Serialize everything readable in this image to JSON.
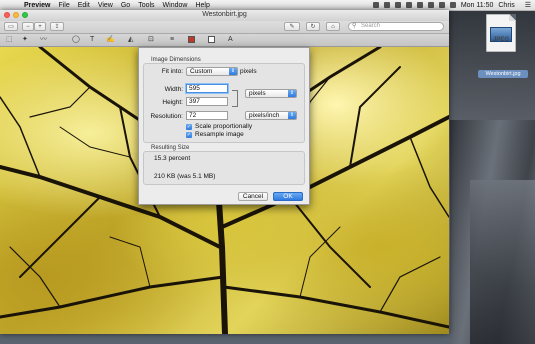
{
  "menubar": {
    "app": "Preview",
    "items": [
      "File",
      "Edit",
      "View",
      "Go",
      "Tools",
      "Window",
      "Help"
    ],
    "clock": "Mon 11:50",
    "user": "Chris"
  },
  "window": {
    "title": "Westonbirt.jpg",
    "search_placeholder": "Search"
  },
  "dialog": {
    "image_dimensions_label": "Image Dimensions",
    "fit_into_label": "Fit into:",
    "fit_into_value": "Custom",
    "fit_into_units": "pixels",
    "width_label": "Width:",
    "width_value": "595",
    "height_label": "Height:",
    "height_value": "397",
    "dim_units": "pixels",
    "resolution_label": "Resolution:",
    "resolution_value": "72",
    "resolution_units": "pixels/inch",
    "scale_proportionally": "Scale proportionally",
    "resample_image": "Resample image",
    "resulting_size_label": "Resulting Size",
    "percent": "15.3 percent",
    "size": "210 KB (was 5.1 MB)",
    "cancel": "Cancel",
    "ok": "OK"
  },
  "desktop": {
    "file_type": "JPEG",
    "file_name": "Westonbirt.jpg"
  },
  "colors": {
    "accent": "#2f7be0",
    "markup_red": "#c0392b"
  }
}
